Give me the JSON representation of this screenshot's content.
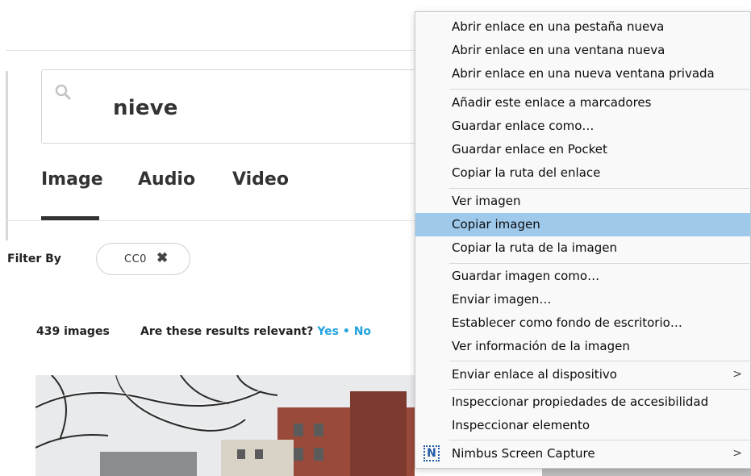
{
  "search": {
    "query": "nieve"
  },
  "tabs": [
    {
      "label": "Image"
    },
    {
      "label": "Audio"
    },
    {
      "label": "Video"
    }
  ],
  "filter": {
    "label": "Filter By",
    "chip_label": "CC0",
    "chip_remove": "✖"
  },
  "results": {
    "count": "439 images",
    "relevant_question": "Are these results relevant?",
    "yes": "Yes",
    "separator": "•",
    "no": "No"
  },
  "context_menu": {
    "items": [
      {
        "label": "Abrir enlace en una pestaña nueva"
      },
      {
        "label": "Abrir enlace en una ventana nueva"
      },
      {
        "label": "Abrir enlace en una nueva ventana privada"
      },
      {
        "label": "Añadir este enlace a marcadores"
      },
      {
        "label": "Guardar enlace como…"
      },
      {
        "label": "Guardar enlace en Pocket"
      },
      {
        "label": "Copiar la ruta del enlace"
      },
      {
        "label": "Ver imagen"
      },
      {
        "label": "Copiar imagen"
      },
      {
        "label": "Copiar la ruta de la imagen"
      },
      {
        "label": "Guardar imagen como…"
      },
      {
        "label": "Enviar imagen…"
      },
      {
        "label": "Establecer como fondo de escritorio…"
      },
      {
        "label": "Ver información de la imagen"
      },
      {
        "label": "Enviar enlace al dispositivo",
        "submenu_arrow": ">"
      },
      {
        "label": "Inspeccionar propiedades de accesibilidad"
      },
      {
        "label": "Inspeccionar elemento"
      },
      {
        "label": "Nimbus Screen Capture",
        "submenu_arrow": ">",
        "icon_glyph": "N"
      }
    ],
    "highlighted_item": "Copiar imagen"
  },
  "colors": {
    "accent_link": "#23a3dd",
    "menu_highlight": "#9ec9eb"
  }
}
